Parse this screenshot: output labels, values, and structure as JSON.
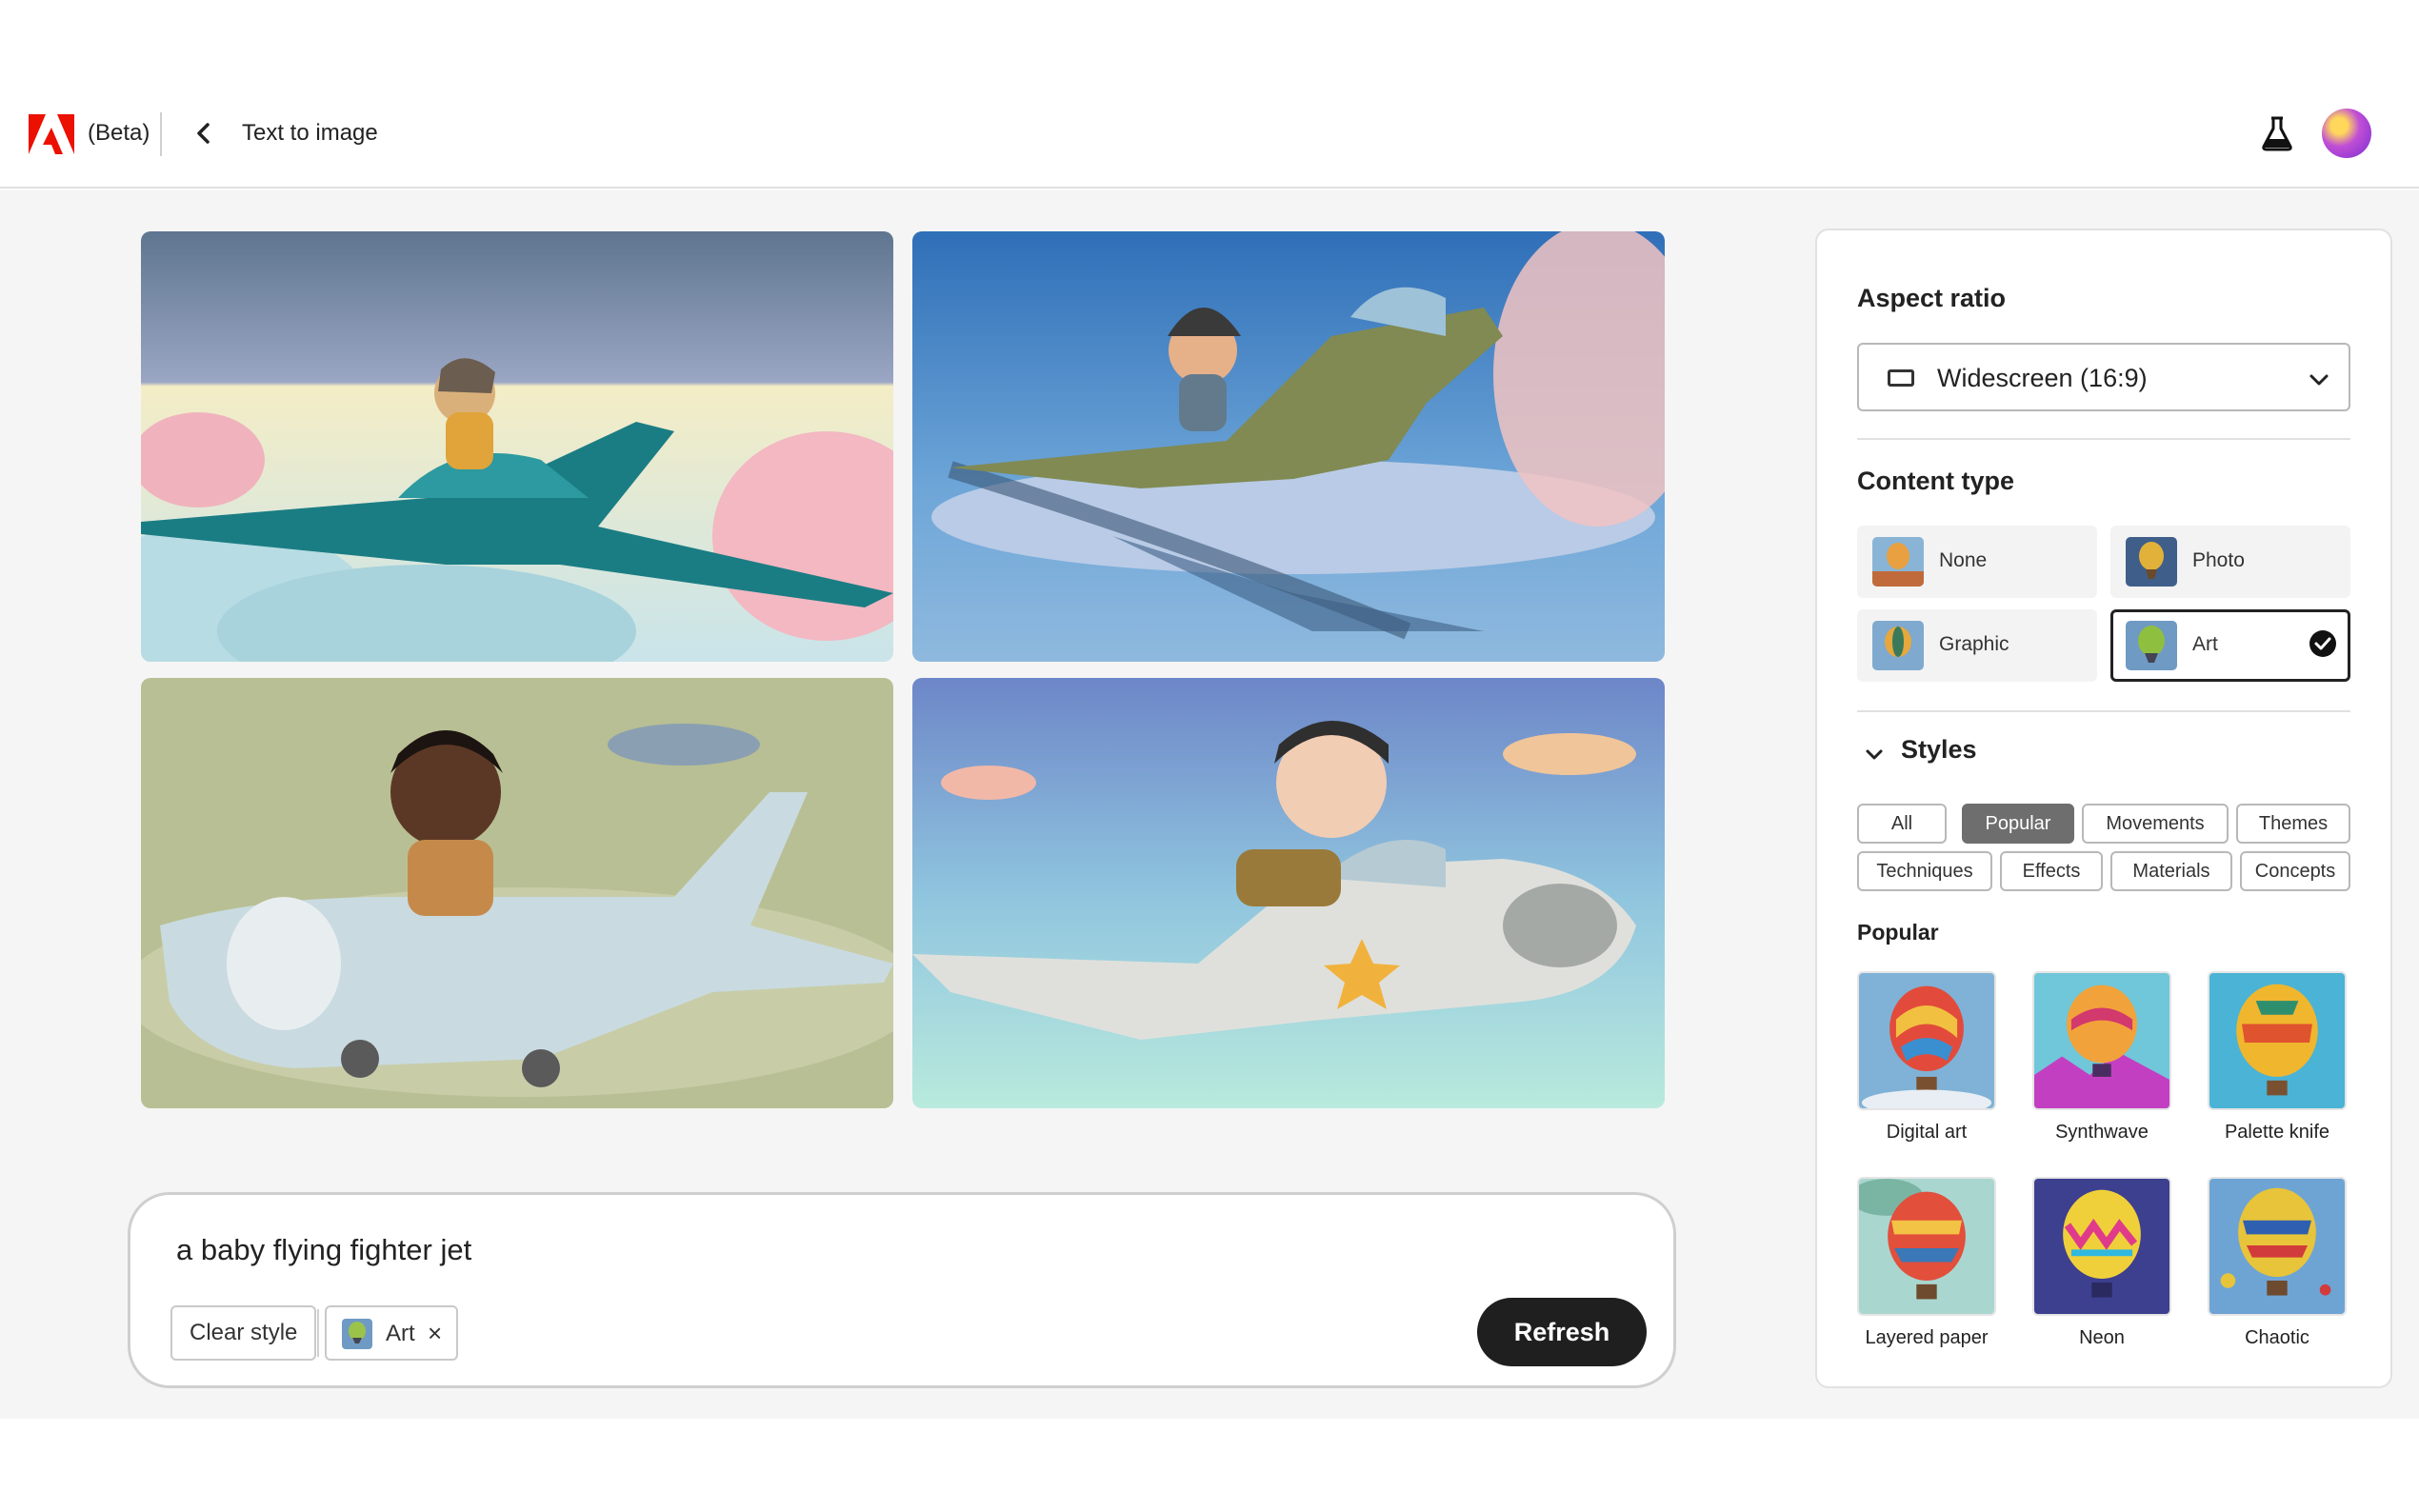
{
  "header": {
    "beta_label": "(Beta)",
    "page_title": "Text to image",
    "icons": [
      "adobe-logo",
      "back-icon",
      "flask-icon",
      "avatar"
    ]
  },
  "gallery": {
    "images": [
      {
        "name": "generated-image-1"
      },
      {
        "name": "generated-image-2"
      },
      {
        "name": "generated-image-3"
      },
      {
        "name": "generated-image-4"
      }
    ]
  },
  "prompt": {
    "text": "a baby flying fighter jet",
    "clear_style_label": "Clear style",
    "applied_style": {
      "label": "Art",
      "remove_glyph": "×"
    },
    "refresh_label": "Refresh"
  },
  "panel": {
    "aspect_ratio": {
      "title": "Aspect ratio",
      "value": "Widescreen (16:9)"
    },
    "content_type": {
      "title": "Content type",
      "options": [
        {
          "label": "None",
          "selected": false
        },
        {
          "label": "Photo",
          "selected": false
        },
        {
          "label": "Graphic",
          "selected": false
        },
        {
          "label": "Art",
          "selected": true
        }
      ]
    },
    "styles": {
      "title": "Styles",
      "tabs": [
        {
          "label": "All",
          "active": false
        },
        {
          "label": "Popular",
          "active": true
        },
        {
          "label": "Movements",
          "active": false
        },
        {
          "label": "Themes",
          "active": false
        },
        {
          "label": "Techniques",
          "active": false
        },
        {
          "label": "Effects",
          "active": false
        },
        {
          "label": "Materials",
          "active": false
        },
        {
          "label": "Concepts",
          "active": false
        }
      ],
      "section_title": "Popular",
      "tiles": [
        {
          "label": "Digital art"
        },
        {
          "label": "Synthwave"
        },
        {
          "label": "Palette knife"
        },
        {
          "label": "Layered paper"
        },
        {
          "label": "Neon"
        },
        {
          "label": "Chaotic"
        }
      ]
    }
  },
  "colors": {
    "adobe_red": "#eb1000",
    "refresh_bg": "#1f1f1f",
    "active_tab_bg": "#6e6e6e"
  }
}
